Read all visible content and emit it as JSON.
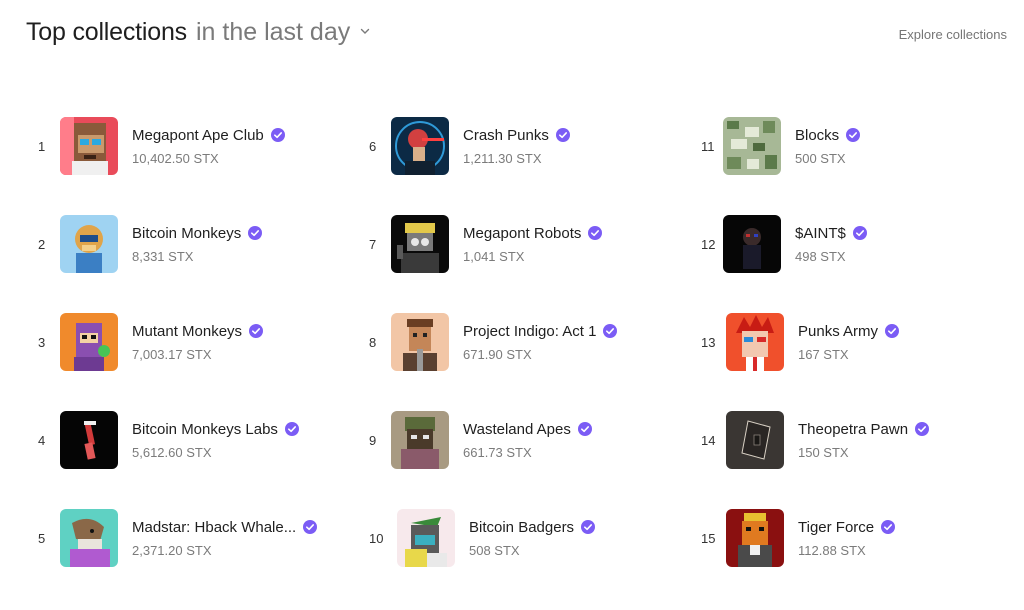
{
  "header": {
    "title": "Top collections",
    "period": "in the last day",
    "explore_label": "Explore collections"
  },
  "colors": {
    "verified": "#7b5cf5",
    "muted_text": "#7a7a7a"
  },
  "collections": [
    {
      "rank": "1",
      "name": "Megapont Ape Club",
      "price": "10,402.50 STX",
      "icon": "ape-avatar-icon"
    },
    {
      "rank": "2",
      "name": "Bitcoin Monkeys",
      "price": "8,331 STX",
      "icon": "monkey-avatar-icon"
    },
    {
      "rank": "3",
      "name": "Mutant Monkeys",
      "price": "7,003.17 STX",
      "icon": "mutant-monkey-avatar-icon"
    },
    {
      "rank": "4",
      "name": "Bitcoin Monkeys Labs",
      "price": "5,612.60 STX",
      "icon": "lab-vial-avatar-icon"
    },
    {
      "rank": "5",
      "name": "Madstar: Hback Whale...",
      "price": "2,371.20 STX",
      "icon": "whale-avatar-icon"
    },
    {
      "rank": "6",
      "name": "Crash Punks",
      "price": "1,211.30 STX",
      "icon": "punk-robot-avatar-icon"
    },
    {
      "rank": "7",
      "name": "Megapont Robots",
      "price": "1,041 STX",
      "icon": "robot-avatar-icon"
    },
    {
      "rank": "8",
      "name": "Project Indigo: Act 1",
      "price": "671.90 STX",
      "icon": "warrior-avatar-icon"
    },
    {
      "rank": "9",
      "name": "Wasteland Apes",
      "price": "661.73 STX",
      "icon": "soldier-ape-avatar-icon"
    },
    {
      "rank": "10",
      "name": "Bitcoin Badgers",
      "price": "508 STX",
      "icon": "badger-avatar-icon"
    },
    {
      "rank": "11",
      "name": "Blocks",
      "price": "500 STX",
      "icon": "camo-blocks-avatar-icon"
    },
    {
      "rank": "12",
      "name": "$AINT$",
      "price": "498 STX",
      "icon": "dark-figure-avatar-icon"
    },
    {
      "rank": "13",
      "name": "Punks Army",
      "price": "167 STX",
      "icon": "punk-redhair-avatar-icon"
    },
    {
      "rank": "14",
      "name": "Theopetra Pawn",
      "price": "150 STX",
      "icon": "card-avatar-icon"
    },
    {
      "rank": "15",
      "name": "Tiger Force",
      "price": "112.88 STX",
      "icon": "tiger-avatar-icon"
    }
  ]
}
